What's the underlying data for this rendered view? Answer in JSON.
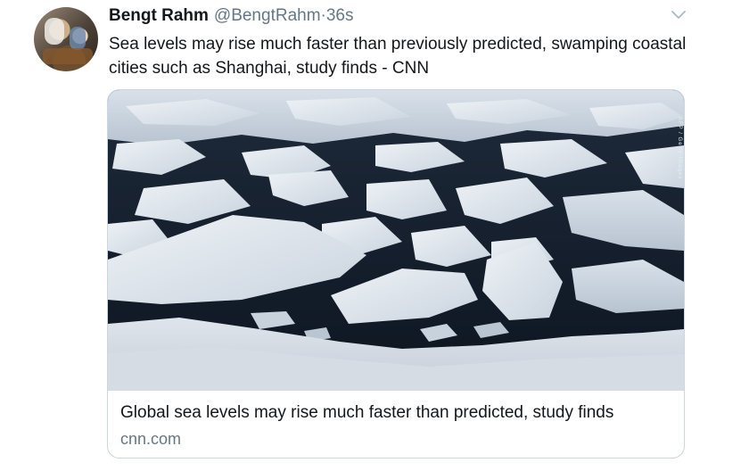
{
  "tweet": {
    "author_name": "Bengt Rahm",
    "author_handle": "@BengtRahm",
    "separator": "·",
    "timestamp": "36s",
    "text": "Sea levels may rise much faster than previously predicted, swamping coastal cities such as Shanghai, study finds - CNN",
    "avatar_icon": "profile-photo",
    "menu_icon": "chevron-down-icon"
  },
  "card": {
    "title": "Global sea levels may rise much faster than predicted, study finds",
    "domain": "cnn.com",
    "image_subject": "aerial photo of broken sea ice floes on dark water",
    "image_credit": "AFP / Getty Images"
  },
  "colors": {
    "text_primary": "#14171a",
    "text_secondary": "#657786",
    "border": "#ccd6dd",
    "water": "#15202e",
    "ice": "#dfe6ee"
  }
}
